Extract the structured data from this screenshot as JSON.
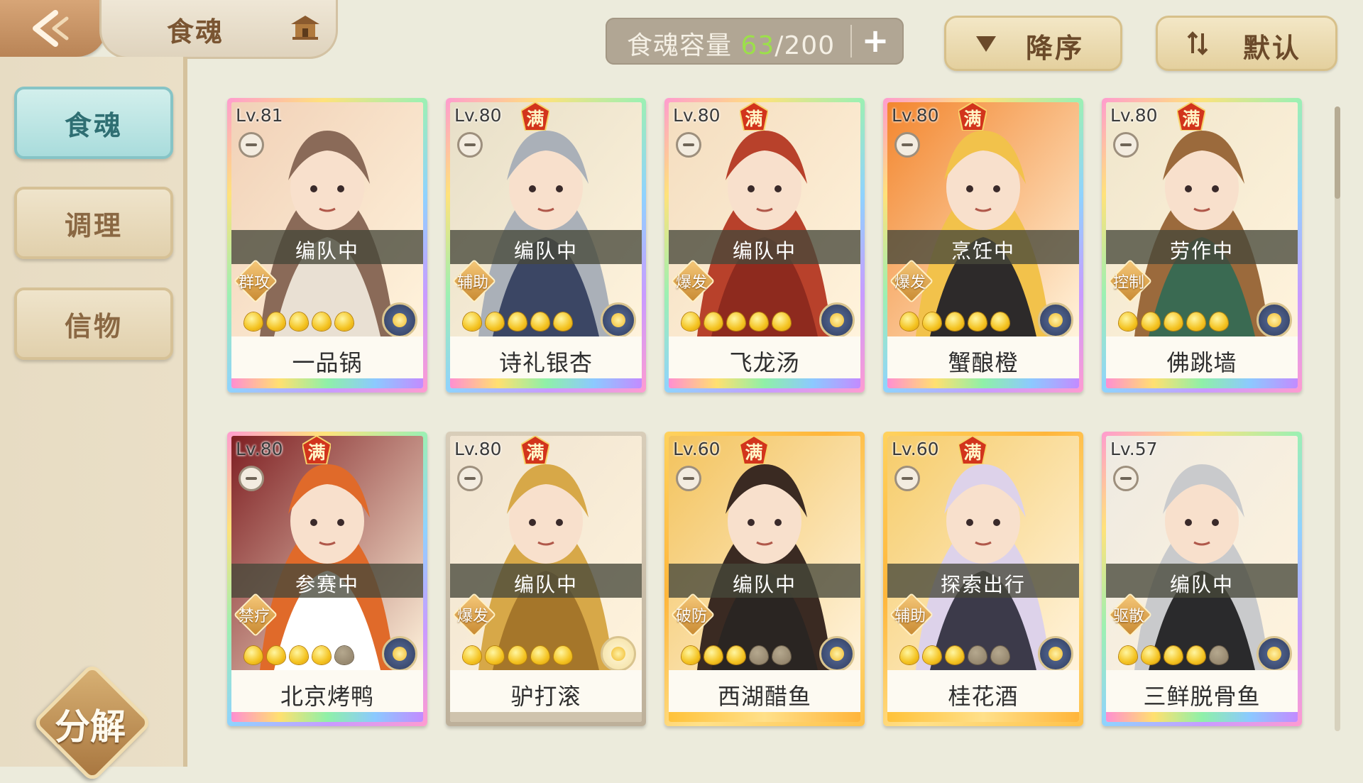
{
  "header": {
    "title": "食魂",
    "capacity_label": "食魂容量 ",
    "capacity_current": "63",
    "capacity_max": "/200",
    "plus_label": "+",
    "sort_order_label": "降序",
    "sort_mode_label": "默认"
  },
  "sidebar": {
    "items": [
      {
        "label": "食魂",
        "active": true
      },
      {
        "label": "调理",
        "active": false
      },
      {
        "label": "信物",
        "active": false
      }
    ],
    "decompose_label": "分解"
  },
  "cards": [
    {
      "level": "Lv.81",
      "full": "",
      "status": "编队中",
      "role": "群攻",
      "stars_lit": 5,
      "name": "一品锅",
      "frame": "rainbow",
      "palette": [
        "#f1d1b7",
        "#8a6a58",
        "#e9e0d3"
      ]
    },
    {
      "level": "Lv.80",
      "full": "满",
      "status": "编队中",
      "role": "辅助",
      "stars_lit": 5,
      "name": "诗礼银杏",
      "frame": "rainbow",
      "palette": [
        "#e7dfc8",
        "#aab0b8",
        "#3b4664"
      ]
    },
    {
      "level": "Lv.80",
      "full": "满",
      "status": "编队中",
      "role": "爆发",
      "stars_lit": 5,
      "name": "飞龙汤",
      "frame": "rainbow",
      "palette": [
        "#f4ddbf",
        "#b8412b",
        "#8e2a1e"
      ]
    },
    {
      "level": "Lv.80",
      "full": "满",
      "status": "烹饪中",
      "role": "爆发",
      "stars_lit": 5,
      "name": "蟹酿橙",
      "frame": "rainbow",
      "palette": [
        "#f3862e",
        "#f2c24b",
        "#2d2a2a"
      ]
    },
    {
      "level": "Lv.80",
      "full": "满",
      "status": "劳作中",
      "role": "控制",
      "stars_lit": 5,
      "name": "佛跳墙",
      "frame": "rainbow",
      "palette": [
        "#f0e6cc",
        "#9b6a3c",
        "#3a6a52"
      ]
    },
    {
      "level": "Lv.80",
      "full": "满",
      "status": "参赛中",
      "role": "禁疗",
      "stars_lit": 4,
      "name": "北京烤鸭",
      "frame": "rainbow",
      "palette": [
        "#7e1f22",
        "#e06a2a",
        "#ffffff"
      ]
    },
    {
      "level": "Lv.80",
      "full": "满",
      "status": "编队中",
      "role": "爆发",
      "stars_lit": 5,
      "name": "驴打滚",
      "frame": "plain",
      "palette": [
        "#efe3d0",
        "#d7a848",
        "#a5762a"
      ]
    },
    {
      "level": "Lv.60",
      "full": "满",
      "status": "编队中",
      "role": "破防",
      "stars_lit": 3,
      "name": "西湖醋鱼",
      "frame": "gold",
      "palette": [
        "#f3c35d",
        "#3a2a22",
        "#2a2522"
      ]
    },
    {
      "level": "Lv.60",
      "full": "满",
      "status": "探索出行",
      "role": "辅助",
      "stars_lit": 3,
      "name": "桂花酒",
      "frame": "gold",
      "palette": [
        "#f6cc6a",
        "#ddd2ea",
        "#3c3a4a"
      ]
    },
    {
      "level": "Lv.57",
      "full": "",
      "status": "编队中",
      "role": "驱散",
      "stars_lit": 4,
      "name": "三鲜脱骨鱼",
      "frame": "rainbow",
      "palette": [
        "#eeeae2",
        "#c9cacc",
        "#2a2a2c"
      ]
    }
  ],
  "colors": {
    "accent_green": "#9ce04a",
    "active_tab": "#a9dcdc",
    "badge_red": "#d2341c"
  }
}
